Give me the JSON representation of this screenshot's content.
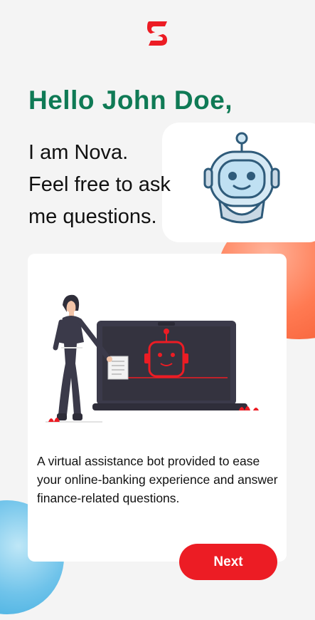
{
  "brand": {
    "logo_icon": "scotiabank-logo-icon",
    "accent_color": "#ec1c24",
    "primary_green": "#0f7a55"
  },
  "greeting": {
    "title": "Hello John Doe,"
  },
  "intro": {
    "lines": [
      "I am Nova.",
      "Feel free to ask",
      "me questions."
    ]
  },
  "assistant": {
    "avatar_icon": "robot-icon",
    "illustration": "woman-presenting-robot-on-laptop"
  },
  "card": {
    "description": "A virtual assistance bot provided to ease your online-banking experience and answer finance-related questions."
  },
  "actions": {
    "next_label": "Next"
  }
}
